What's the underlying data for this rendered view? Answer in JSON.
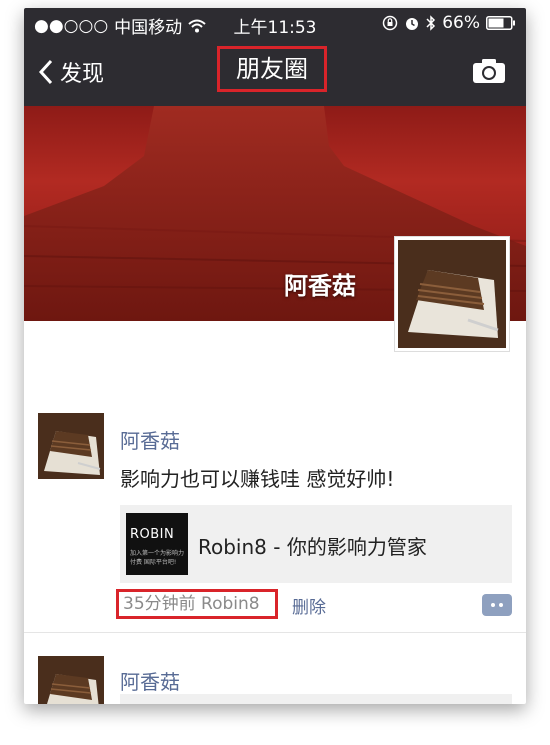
{
  "status_bar": {
    "signal": "●●○○○",
    "carrier": "中国移动",
    "time": "上午11:53",
    "battery": "66%"
  },
  "nav": {
    "back_label": "发现",
    "title": "朋友圈",
    "camera_icon": "camera-icon"
  },
  "cover": {
    "user_name": "阿香菇"
  },
  "posts": [
    {
      "name": "阿香菇",
      "text": "影响力也可以赚钱哇 感觉好帅!",
      "link": {
        "thumb_text": "ROBIN",
        "thumb_subtext": "加入第一个为影响力付费 国际平台吧!",
        "title": "Robin8 - 你的影响力管家"
      },
      "meta": "35分钟前   Robin8",
      "delete_label": "删除"
    },
    {
      "name": "阿香菇"
    }
  ],
  "colors": {
    "bar_bg": "#2d2c31",
    "highlight": "#d9242a",
    "name_blue": "#586b95"
  }
}
